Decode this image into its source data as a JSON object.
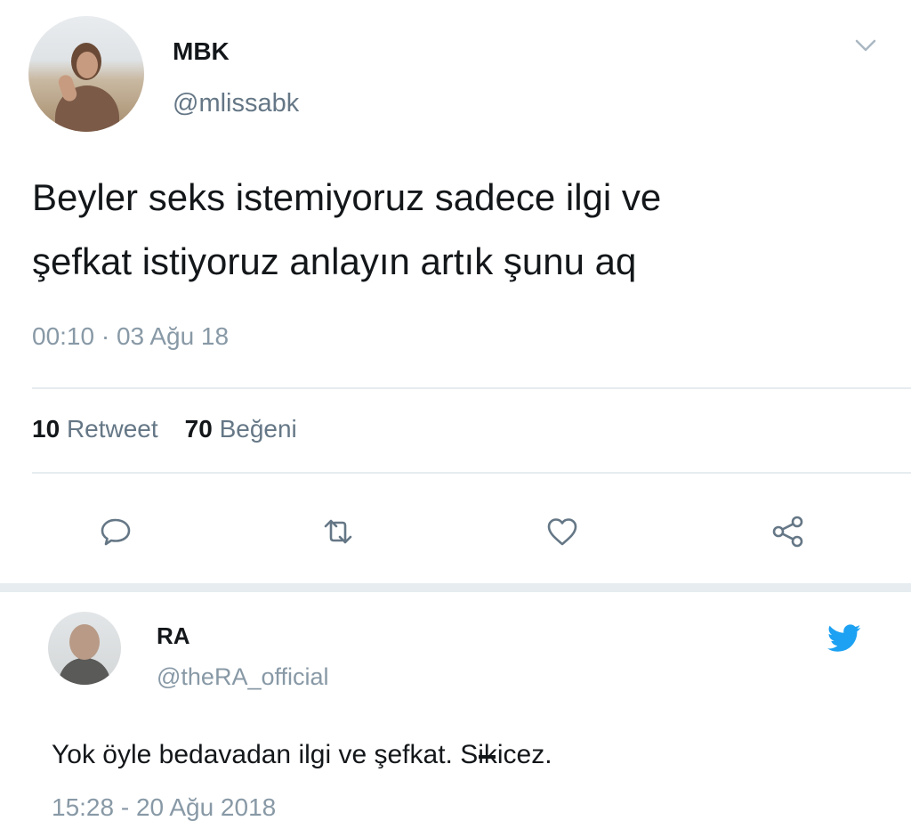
{
  "tweet": {
    "author_name": "MBK",
    "author_handle": "@mlissabk",
    "text_line1": "Beyler seks istemiyoruz sadece ilgi ve",
    "text_line2": "şefkat istiyoruz anlayın artık şunu aq",
    "timestamp": "00:10 · 03 Ağu 18",
    "retweet_count": "10",
    "retweet_label": "Retweet",
    "like_count": "70",
    "like_label": "Beğeni",
    "actions": [
      "reply-icon",
      "retweet-icon",
      "like-icon",
      "share-icon"
    ],
    "menu_icon": "chevron-down-icon"
  },
  "reply": {
    "author_name": "RA",
    "author_handle": "@theRA_official",
    "text_before": "Yok öyle bedavadan ilgi ve şefkat. S",
    "text_struck": "ik",
    "text_after": "icez.",
    "timestamp": "15:28 - 20 Ağu 2018",
    "source_icon": "twitter-bird-icon"
  },
  "colors": {
    "text_primary": "#14171a",
    "text_secondary": "#657786",
    "text_muted": "#8899a6",
    "divider": "#e6ecf0",
    "twitter_blue": "#1da1f2"
  }
}
